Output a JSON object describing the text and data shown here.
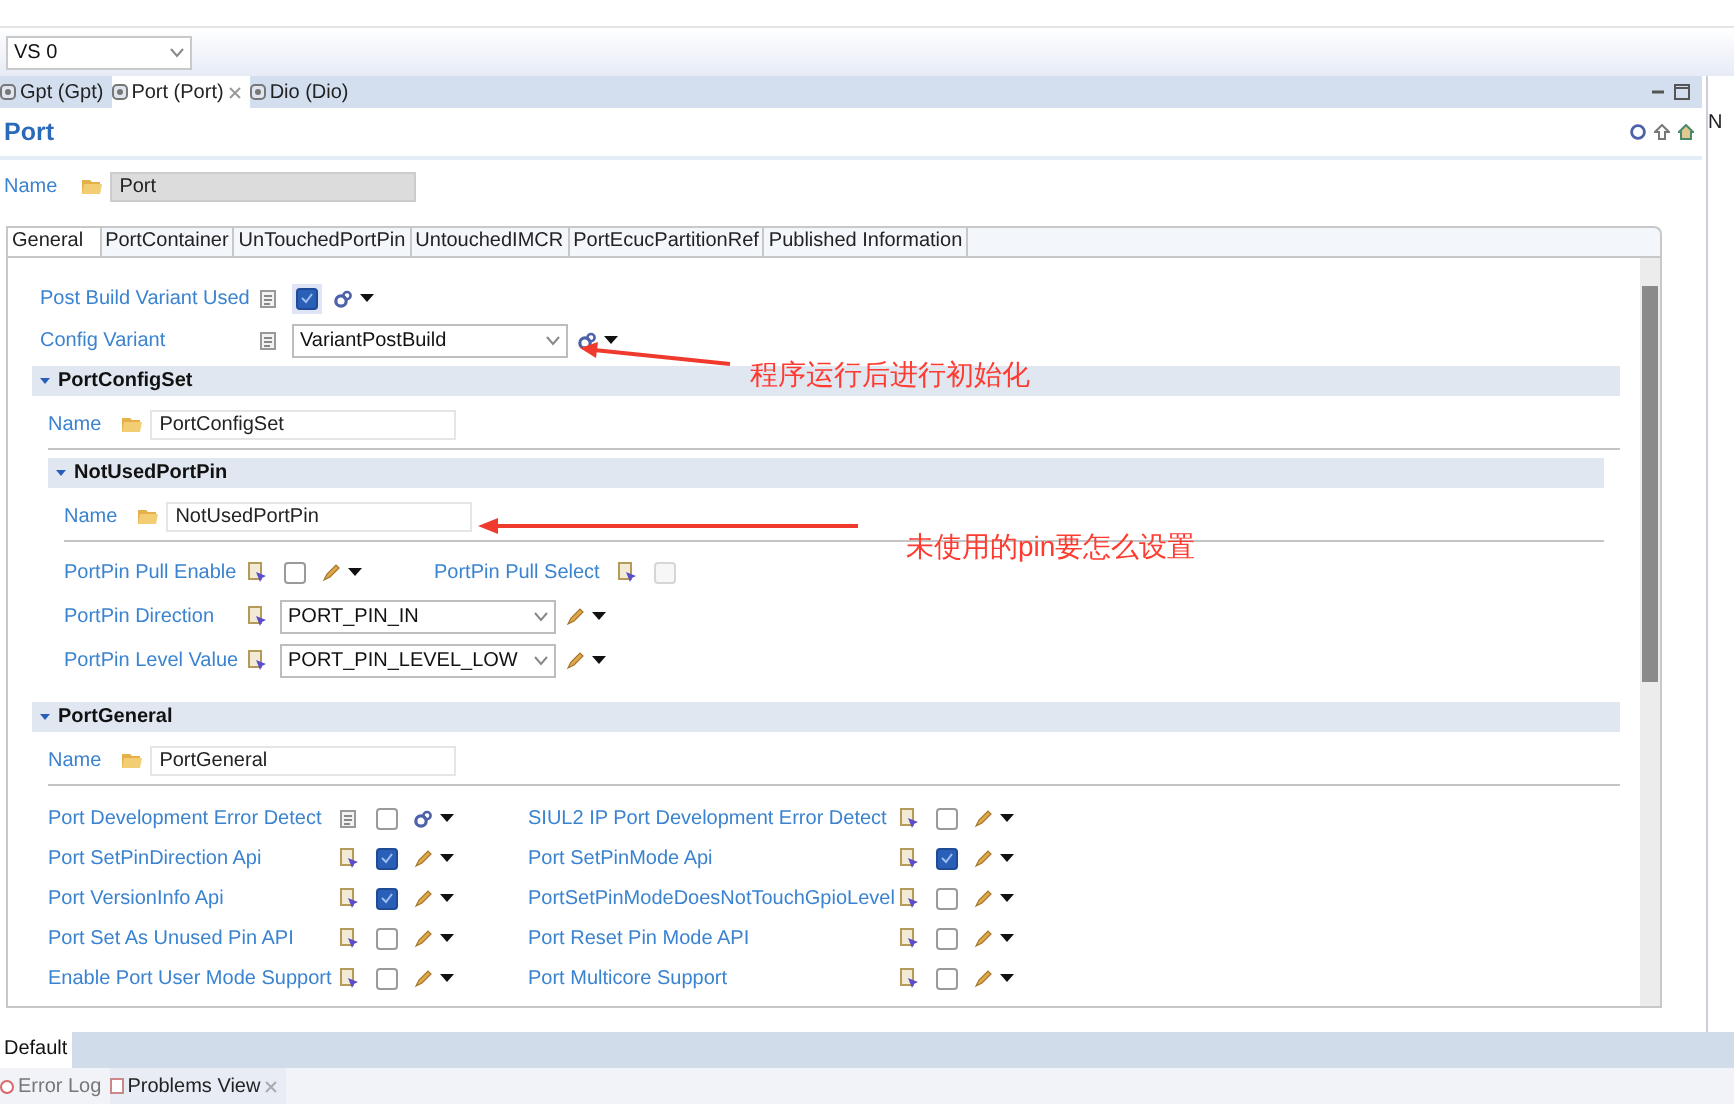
{
  "toolbar": {
    "variant_combo": "VS 0"
  },
  "editor_tabs": [
    {
      "label": "Gpt (Gpt)",
      "selected": false
    },
    {
      "label": "Port (Port)",
      "selected": true
    },
    {
      "label": "Dio (Dio)",
      "selected": false
    }
  ],
  "side_panel": {
    "label": "N"
  },
  "editor": {
    "title": "Port",
    "name_label": "Name",
    "name_value": "Port",
    "tabs": [
      {
        "label": "General",
        "selected": true
      },
      {
        "label": "PortContainer",
        "selected": false
      },
      {
        "label": "UnTouchedPortPin",
        "selected": false
      },
      {
        "label": "UntouchedIMCR",
        "selected": false
      },
      {
        "label": "PortEcucPartitionRef",
        "selected": false
      },
      {
        "label": "Published Information",
        "selected": false
      }
    ],
    "fields": [
      {
        "kind": "checkbox",
        "label": "Post Build Variant Used",
        "checked": true,
        "calculated": true
      },
      {
        "kind": "combo",
        "label": "Config Variant",
        "value": "VariantPostBuild",
        "calculated": true
      }
    ],
    "sections": [
      {
        "title": "PortConfigSet",
        "name_label": "Name",
        "name_value": "PortConfigSet",
        "children": [
          {
            "title": "NotUsedPortPin",
            "name_label": "Name",
            "name_value": "NotUsedPortPin",
            "rows": [
              [
                {
                  "kind": "checkbox",
                  "label": "PortPin Pull Enable",
                  "checked": false,
                  "disabled": false,
                  "calculated": false
                },
                {
                  "kind": "checkbox",
                  "label": "PortPin Pull Select",
                  "checked": false,
                  "disabled": true,
                  "calculated": false
                }
              ],
              [
                {
                  "kind": "combo",
                  "label": "PortPin Direction",
                  "value": "PORT_PIN_IN",
                  "calculated": false
                }
              ],
              [
                {
                  "kind": "combo",
                  "label": "PortPin Level Value",
                  "value": "PORT_PIN_LEVEL_LOW",
                  "calculated": false
                }
              ]
            ]
          }
        ]
      },
      {
        "title": "PortGeneral",
        "name_label": "Name",
        "name_value": "PortGeneral",
        "rows": [
          [
            {
              "kind": "checkbox",
              "label": "Port Development Error Detect",
              "checked": false,
              "disabled": false,
              "calculated": true
            },
            {
              "kind": "checkbox",
              "label": "SIUL2 IP Port Development Error Detect",
              "checked": false,
              "disabled": false,
              "calculated": false
            }
          ],
          [
            {
              "kind": "checkbox",
              "label": "Port SetPinDirection Api",
              "checked": true,
              "disabled": false,
              "calculated": false
            },
            {
              "kind": "checkbox",
              "label": "Port SetPinMode Api",
              "checked": true,
              "disabled": false,
              "calculated": false
            }
          ],
          [
            {
              "kind": "checkbox",
              "label": "Port VersionInfo Api",
              "checked": true,
              "disabled": false,
              "calculated": false
            },
            {
              "kind": "checkbox",
              "label": "PortSetPinModeDoesNotTouchGpioLevel",
              "checked": false,
              "disabled": false,
              "calculated": false
            }
          ],
          [
            {
              "kind": "checkbox",
              "label": "Port Set As Unused Pin API",
              "checked": false,
              "disabled": false,
              "calculated": false
            },
            {
              "kind": "checkbox",
              "label": "Port Reset Pin Mode API",
              "checked": false,
              "disabled": false,
              "calculated": false
            }
          ],
          [
            {
              "kind": "checkbox",
              "label": "Enable Port User Mode Support",
              "checked": false,
              "disabled": false,
              "calculated": false
            },
            {
              "kind": "checkbox",
              "label": "Port Multicore Support",
              "checked": false,
              "disabled": false,
              "calculated": false
            }
          ]
        ]
      }
    ]
  },
  "layout_bar": {
    "label": "Default"
  },
  "view_tabs": [
    {
      "label": "Error Log",
      "selected": false
    },
    {
      "label": "Problems View",
      "selected": true
    }
  ],
  "annotations": [
    {
      "text": "程序运行后进行初始化"
    },
    {
      "text": "未使用的pin要怎么设置"
    }
  ]
}
